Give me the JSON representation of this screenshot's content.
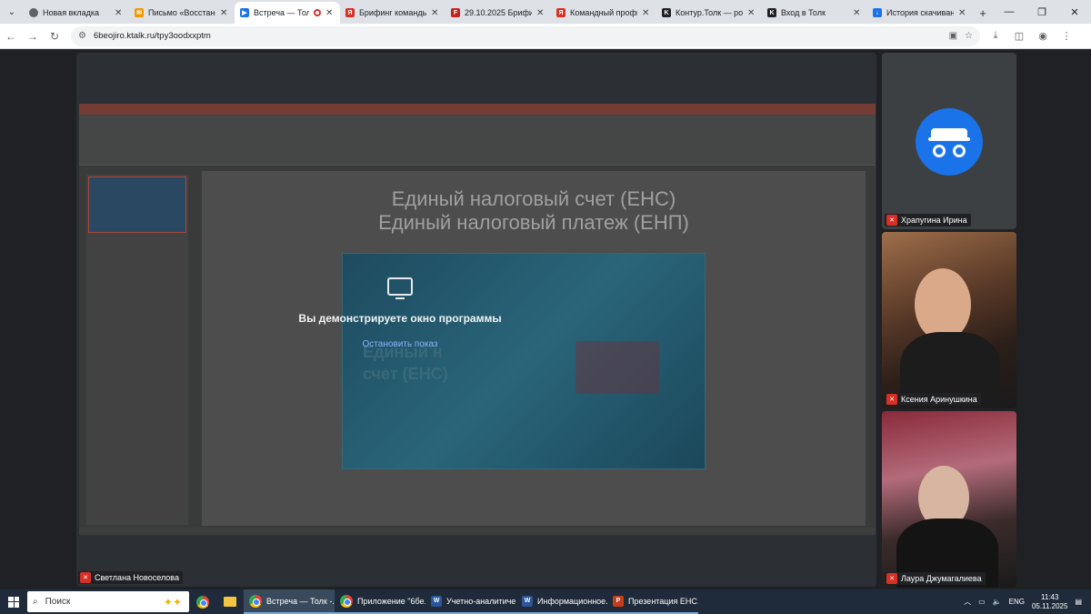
{
  "browser": {
    "tabs": [
      {
        "title": "Новая вкладка",
        "favicon": "chrome-icon",
        "color": "#5f6368"
      },
      {
        "title": "Письмо «Восстановл",
        "favicon": "mail-icon",
        "color": "#f29900"
      },
      {
        "title": "Встреча — Толк",
        "favicon": "video-icon",
        "color": "#1a73e8",
        "active": true
      },
      {
        "title": "Брифинг команды ол",
        "favicon": "doc-icon",
        "color": "#d93025"
      },
      {
        "title": "29.10.2025 Брифинг",
        "favicon": "doc-icon",
        "color": "#c5221f"
      },
      {
        "title": "Командный профиль",
        "favicon": "doc-icon",
        "color": "#d93025"
      },
      {
        "title": "Контур.Толк — росс",
        "favicon": "k-icon",
        "color": "#202124"
      },
      {
        "title": "Вход в Толк",
        "favicon": "k-icon",
        "color": "#202124"
      },
      {
        "title": "История скачивани",
        "favicon": "download-icon",
        "color": "#1a73e8"
      }
    ],
    "url": "6beojiro.ktalk.ru/tpy3oodxxptm"
  },
  "presentation": {
    "slide_title_line1": "Единый налоговый счет (ЕНС)",
    "slide_title_line2": "Единый налоговый платеж (ЕНП)",
    "slide_big_line1": "Единый н",
    "slide_big_line2": "счет (ЕНС)"
  },
  "screen_share": {
    "message": "Вы демонстрируете окно программы",
    "stop_label": "Остановить показ"
  },
  "participants": [
    {
      "name": "Храпугина Ирина",
      "avatar": "incognito-icon"
    },
    {
      "name": "Ксения Аринушкина"
    },
    {
      "name": "Лаура Джумагалиева"
    }
  ],
  "stage_participant": "Светлана Новоселова",
  "taskbar": {
    "search_placeholder": "Поиск",
    "apps": [
      {
        "label": "Встреча — Толк -...",
        "icon": "chrome-icon",
        "active": true
      },
      {
        "label": "Приложение \"6бе...",
        "icon": "chrome-icon"
      },
      {
        "label": "Учетно-аналитиче...",
        "icon": "word-icon",
        "color": "#2b579a"
      },
      {
        "label": "Информационное...",
        "icon": "word-icon",
        "color": "#2b579a"
      },
      {
        "label": "Презентация ЕНС....",
        "icon": "powerpoint-icon",
        "color": "#c43e1c"
      }
    ],
    "lang": "ENG",
    "time": "11:43",
    "date": "05.11.2025"
  }
}
